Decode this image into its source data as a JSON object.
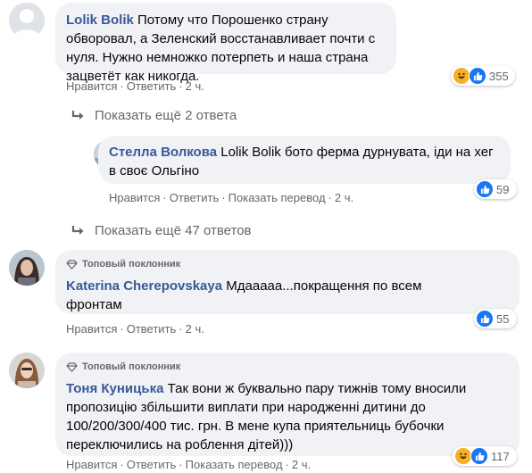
{
  "colors": {
    "bubble": "#f0f2f5",
    "author": "#385898",
    "meta": "#65676b",
    "like": "#1877f2",
    "haha": "#f7b125"
  },
  "comments": [
    {
      "author": "Lolik Bolik",
      "text": "Потому что Порошенко страну обворовал, а Зеленский восстанавливает почти с нуля. Нужно немножко потерпеть и наша страна зацветёт как никогда.",
      "actions": {
        "like": "Нравится",
        "reply": "Ответить",
        "time": "2 ч."
      },
      "reactions": {
        "icons": [
          "haha",
          "like"
        ],
        "count": "355"
      }
    },
    {
      "author": "Стелла Волкова",
      "text": "Lolik Bolik бото ферма дурнувата, іди на хег в своє Ольгіно",
      "actions": {
        "like": "Нравится",
        "reply": "Ответить",
        "translate": "Показать перевод",
        "time": "2 ч."
      },
      "reactions": {
        "icons": [
          "like"
        ],
        "count": "59"
      }
    },
    {
      "badge": "Топовый поклонник",
      "author": "Katerina Cherepovskaya",
      "text": "Мдааааа...покращення по всем фронтам",
      "actions": {
        "like": "Нравится",
        "reply": "Ответить",
        "time": "2 ч."
      },
      "reactions": {
        "icons": [
          "like"
        ],
        "count": "55"
      }
    },
    {
      "badge": "Топовый поклонник",
      "author": "Тоня Куницька",
      "text": "Так вони ж буквально пару тижнів тому вносили пропозицію збільшити виплати при народженні дитини до 100/200/300/400 тис. грн. В мене купа приятельниць бубочки переключились на роблення дітей)))",
      "actions": {
        "like": "Нравится",
        "reply": "Ответить",
        "translate": "Показать перевод",
        "time": "2 ч."
      },
      "reactions": {
        "icons": [
          "haha",
          "like"
        ],
        "count": "117"
      }
    }
  ],
  "more_replies": [
    {
      "label": "Показать ещё 2 ответа"
    },
    {
      "label": "Показать ещё 47 ответов"
    }
  ]
}
